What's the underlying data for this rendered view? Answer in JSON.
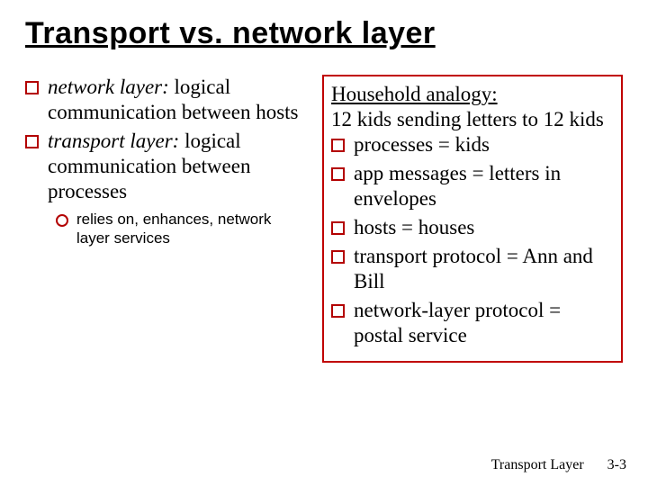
{
  "title": "Transport vs. network layer",
  "left": {
    "items": [
      {
        "lead": "network layer:",
        "rest": " logical communication between hosts"
      },
      {
        "lead": "transport layer:",
        "rest": " logical communication between processes"
      }
    ],
    "sub": "relies on, enhances, network layer services"
  },
  "right": {
    "heading": "Household analogy:",
    "intro": "12 kids sending letters to 12 kids",
    "items": [
      "processes = kids",
      "app messages = letters in envelopes",
      "hosts = houses",
      "transport protocol = Ann and Bill",
      "network-layer protocol = postal service"
    ]
  },
  "footer": {
    "label": "Transport Layer",
    "page": "3-3"
  }
}
